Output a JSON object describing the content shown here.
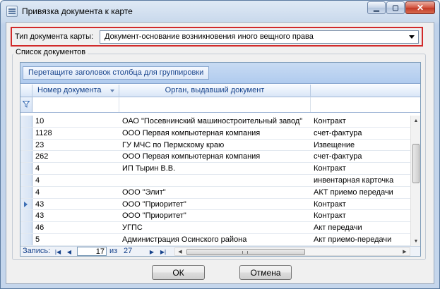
{
  "window": {
    "title": "Привязка документа к карте",
    "minimize_glyph": "▁",
    "maximize_glyph": "▢",
    "close_glyph": "✕"
  },
  "doc_type": {
    "label": "Тип документа карты:",
    "value": "Документ-основание возникновения иного вещного права"
  },
  "documents": {
    "group_title": "Список документов",
    "group_hint": "Перетащите заголовок столбца для группировки",
    "columns": [
      "Номер документа",
      "Орган, выдавший документ",
      ""
    ],
    "rows": [
      {
        "number": "10",
        "issuer": "ОАО \"Посевнинский машиностроительный завод\"",
        "type": "Контракт"
      },
      {
        "number": "1128",
        "issuer": "ООО Первая компьютерная компания",
        "type": "счет-фактура"
      },
      {
        "number": "23",
        "issuer": "ГУ МЧС по Пермскому краю",
        "type": "Извещение"
      },
      {
        "number": "262",
        "issuer": "ООО Первая компьютерная компания",
        "type": "счет-фактура"
      },
      {
        "number": "4",
        "issuer": "ИП Тырин В.В.",
        "type": "Контракт"
      },
      {
        "number": "4",
        "issuer": "",
        "type": "инвентарная карточка"
      },
      {
        "number": "4",
        "issuer": "ООО \"Элит\"",
        "type": "АКТ приемо передачи"
      },
      {
        "number": "43",
        "issuer": "ООО \"Приоритет\"",
        "type": "Контракт"
      },
      {
        "number": "43",
        "issuer": "ООО \"Приоритет\"",
        "type": "Контракт"
      },
      {
        "number": "46",
        "issuer": "УГПС",
        "type": "Акт передачи"
      },
      {
        "number": "5",
        "issuer": "Администрация Осинского района",
        "type": "Акт приемо-передачи"
      }
    ],
    "current_row_index": 7
  },
  "navigator": {
    "label": "Запись:",
    "current": "17",
    "of_label": "из",
    "total": "27"
  },
  "buttons": {
    "ok": "ОК",
    "cancel": "Отмена"
  }
}
